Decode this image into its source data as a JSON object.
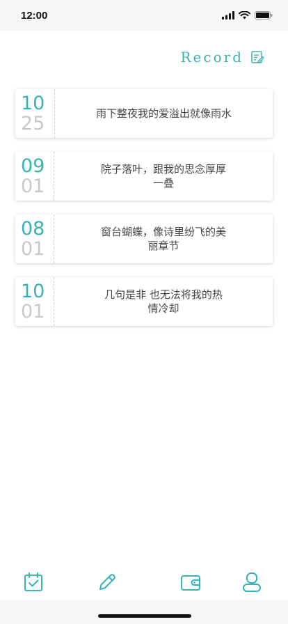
{
  "status_bar": {
    "time": "12:00"
  },
  "header": {
    "title": "Record",
    "icon": "edit-note-icon"
  },
  "entries": [
    {
      "month": "10",
      "day": "25",
      "text": "雨下整夜我的爱溢出就像雨水"
    },
    {
      "month": "09",
      "day": "01",
      "text": "院子落叶，跟我的思念厚厚一叠"
    },
    {
      "month": "08",
      "day": "01",
      "text": "窗台蝴蝶，像诗里纷飞的美丽章节"
    },
    {
      "month": "10",
      "day": "01",
      "text": "几句是非 也无法将我的热情冷却"
    }
  ],
  "tabbar": {
    "items": [
      {
        "icon": "calendar-check-icon"
      },
      {
        "icon": "pencil-icon"
      },
      {
        "icon": "wallet-icon"
      },
      {
        "icon": "user-icon"
      }
    ]
  },
  "colors": {
    "accent": "#37b3b8",
    "day_gray": "#c8c8c8",
    "text": "#444444"
  }
}
